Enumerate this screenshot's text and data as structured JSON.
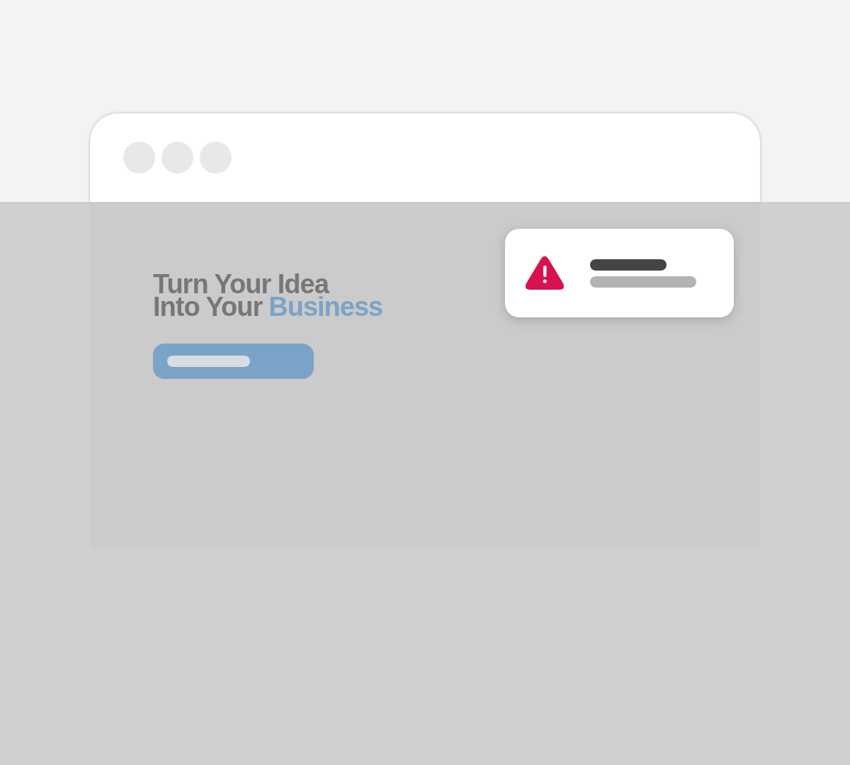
{
  "window": {
    "controls": [
      {
        "kind": "dot"
      },
      {
        "kind": "dot"
      },
      {
        "kind": "dot"
      }
    ]
  },
  "headline": {
    "lines": [
      {
        "parts": [
          {
            "text": "Turn Your Idea",
            "highlight": false
          }
        ]
      },
      {
        "parts": [
          {
            "text": "Into Your",
            "highlight": false
          },
          {
            "text": "Business",
            "highlight": true
          }
        ]
      }
    ]
  },
  "cta": {
    "kind": "skeleton"
  },
  "toast": {
    "kind": "warning"
  }
}
